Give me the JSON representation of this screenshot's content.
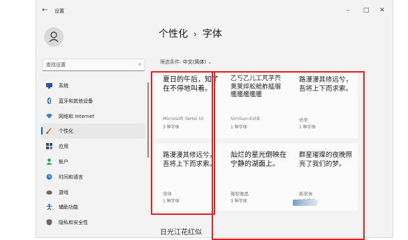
{
  "window": {
    "title": "设置",
    "controls": {
      "minimize": "–",
      "maximize": "□",
      "close": "✕"
    }
  },
  "search": {
    "placeholder": "查找设置",
    "icon": "search-icon"
  },
  "nav": {
    "items": [
      {
        "label": "系统",
        "icon": "monitor-icon",
        "color": "#2b5797"
      },
      {
        "label": "蓝牙和其他设备",
        "icon": "bluetooth-icon",
        "color": "#0067c0"
      },
      {
        "label": "网络和 Internet",
        "icon": "wifi-icon",
        "color": "#3b82c4"
      },
      {
        "label": "个性化",
        "icon": "brush-icon",
        "color": "#d26a2b",
        "selected": true
      },
      {
        "label": "应用",
        "icon": "apps-icon",
        "color": "#3a4c66"
      },
      {
        "label": "帐户",
        "icon": "person-icon",
        "color": "#1e9e63"
      },
      {
        "label": "时间和语言",
        "icon": "globe-icon",
        "color": "#2f7fd4"
      },
      {
        "label": "游戏",
        "icon": "gamepad-icon",
        "color": "#6b6b6b"
      },
      {
        "label": "辅助功能",
        "icon": "accessibility-icon",
        "color": "#1a5aa6"
      },
      {
        "label": "隐私和安全性",
        "icon": "shield-icon",
        "color": "#6b6b6b"
      }
    ]
  },
  "breadcrumb": {
    "parent": "个性化",
    "separator": "›",
    "current": "字体"
  },
  "filter": {
    "label": "筛选条件:",
    "value": "中文(简体)",
    "chevron": "⌄"
  },
  "fonts": [
    {
      "preview": "夏日的午后，知了在不停地叫着。",
      "name": "Microsoft YaHei UI",
      "count": "3 种字体"
    },
    {
      "preview": "乙丂乙儿工芃芓茓荚荚焠舩舱舴艋艒艦艦艦艦艦",
      "name": "SimSun-ExtB",
      "count": "1 种字体"
    },
    {
      "preview": "路漫漫其修远兮，吾将上下而求索。",
      "name": "仿宋",
      "count": "1 种字体"
    },
    {
      "preview": "路漫漫其修远兮，吾将上下而求索。",
      "name": "宋体",
      "count": "1 种字体"
    },
    {
      "preview": "灿烂的星光倒映在宁静的湖面上。",
      "name": "微软雅黑",
      "count": "3 种字体"
    },
    {
      "preview": "群星璀璨的夜晚照亮了我们的梦。",
      "name": "新宋体",
      "count": "1 种字体"
    }
  ],
  "partial_text": "日光江花红似",
  "highlight_color": "#e02020"
}
